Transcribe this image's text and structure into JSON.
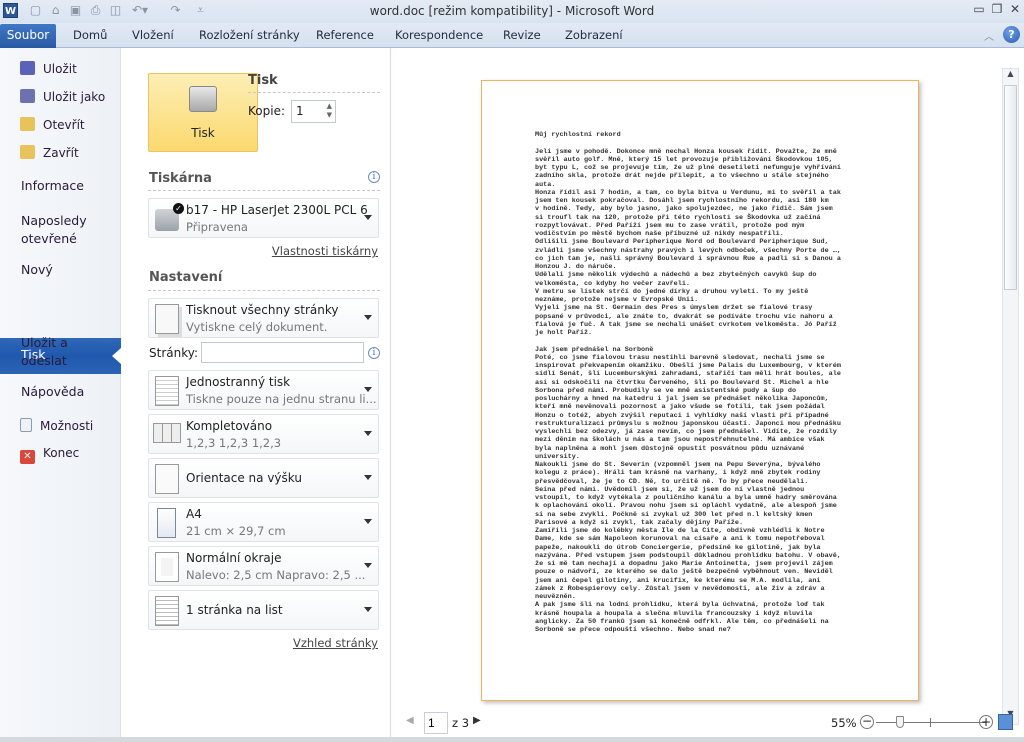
{
  "window": {
    "title": "word.doc [režim kompatibility]  -  Microsoft Word",
    "app_icon": "W"
  },
  "ribbon": {
    "tabs": [
      {
        "label": "Soubor"
      },
      {
        "label": "Domů"
      },
      {
        "label": "Vložení"
      },
      {
        "label": "Rozložení stránky"
      },
      {
        "label": "Reference"
      },
      {
        "label": "Korespondence"
      },
      {
        "label": "Revize"
      },
      {
        "label": "Zobrazení"
      }
    ],
    "help": "?"
  },
  "nav": {
    "items": [
      {
        "label": "Uložit"
      },
      {
        "label": "Uložit jako"
      },
      {
        "label": "Otevřít"
      },
      {
        "label": "Zavřít"
      },
      {
        "label": "Informace"
      },
      {
        "label": "Naposledy otevřené"
      },
      {
        "label": "Nový"
      },
      {
        "label": "Tisk"
      },
      {
        "label": "Uložit a odeslat"
      },
      {
        "label": "Nápověda"
      },
      {
        "label": "Možnosti"
      },
      {
        "label": "Konec"
      }
    ],
    "selected": "Tisk",
    "accent": "#2a5ea8"
  },
  "print": {
    "button_label": "Tisk",
    "heading": "Tisk",
    "copies_label": "Kopie:",
    "copies_value": "1",
    "printer_heading": "Tiskárna",
    "printer_name": "b17 - HP LaserJet 2300L PCL 6",
    "printer_status": "Připravena",
    "printer_props_link": "Vlastnosti tiskárny",
    "settings_heading": "Nastavení",
    "pages_label": "Stránky:",
    "pages_value": "",
    "settings": [
      {
        "title": "Tisknout všechny stránky",
        "subtitle": "Vytiskne celý dokument."
      },
      {
        "title": "Jednostranný tisk",
        "subtitle": "Tiskne pouze na jednu stranu li..."
      },
      {
        "title": "Kompletováno",
        "subtitle": "1,2,3    1,2,3    1,2,3"
      },
      {
        "title": "Orientace na výšku",
        "subtitle": ""
      },
      {
        "title": "A4",
        "subtitle": "21 cm × 29,7 cm"
      },
      {
        "title": "Normální okraje",
        "subtitle": "Nalevo:  2,5 cm   Napravo:  2,5 ..."
      },
      {
        "title": "1 stránka na list",
        "subtitle": ""
      }
    ],
    "page_setup_link": "Vzhled stránky"
  },
  "preview": {
    "current_page": "1",
    "of_pages": "z 3",
    "zoom": "55%",
    "zoom_fraction": 0.22,
    "lines": [
      "Můj rychlostní rekord",
      "",
      "Jeli jsme v pohodě. Dokonce mně nechal Honza kousek řídit. Považte, že mně",
      "svěřil auto golf. Mně, který 15 let provozuje přibližování Škodovkou 105,",
      "byt typu L, což se projevuje tím, že už plné desetiletí nefunguje vyhřívání",
      "zadního skla, protože drát nejde přilepit, a to všechno u stále stejného",
      "auta.",
      "Honza řídil asi 7 hodin, a tam, co byla bitva u Verdunu, mi to svěřil a tak",
      "jsem ten kousek pokračoval. Dosáhl jsem rychlostního rekordu, asi 180 km",
      "v hodině. Tedy, aby bylo jasno, jako spolujezdec, ne jako řidič. Sám jsem",
      "si troufl tak na 120, protože při této rychlosti se Škodovka už začíná",
      "rozpytlovávat. Před Paříží jsem mu to zase vrátil, protože pod mým",
      "vodičstvím po městě bychom naše příbuzné už nikdy nespatřili.",
      "Odlišili jsme Boulevard Peripherique Nord od Boulevard Peripherique Sud,",
      "zvládli jsme všechny nástrahy pravých i levých odboček, všechny Porte de …,",
      "co jich tam je, našli správný Boulevard i správnou Rue a padli si s Danou a",
      "Honzou J. do náruče.",
      "Udělali jsme několik výdechů a nádechů a bez zbytečných cavyků šup do",
      "velkoměsta, co kdyby ho večer zavřeli.",
      "V metru se lístek strčí do jedné dírky a druhou vyletí. To my ještě",
      "neznáme, protože nejsme v Evropské Unii.",
      "Vyjeli jsme na St. Germain des Pres s úmyslem držet se fialové trasy",
      "popsané v průvodci, ale znáte to, dvakrát se podíváte trochu víc nahoru a",
      "fialová je fuč. A tak jsme se nechali unášet cvrkotem velkoměsta. Jó Paříž",
      "je holt Paříž.",
      "",
      "Jak jsem přednášel na Sorboně",
      "Poté, co jsme fialovou trasu nestihli barevně sledovat, nechali jsme se",
      "inspirovat překvapením okamžiku. Obešli jsme Palais du Luxembourg, v kterém",
      "sídlí Senát, šli Lucemburskými zahradami, stařičí tam měli hrát boules, ale",
      "asi si odskočili na čtvrtku Červeného, šli po Boulevard St. Michel a hle",
      "Sorbona před námi. Probudily se ve mně asistentské pudy a šup do",
      "posluchárny a hned na katedru i jal jsem se přednášet několika Japoncům,",
      "kteří mně nevěnovali pozornost a jako všude se fotili, tak jsem požádal",
      "Honzu o totéž, abych zvýšil reputaci i vyhlídky naší vlasti při případné",
      "restrukturalizaci průmyslu s možnou japonskou účastí. Japonci mou přednášku",
      "vyslechli bez odezvy, já zase nevím, co jsem přednášel. Vidíte, že rozdíly",
      "mezi děním na školách u nás a tam jsou nepostřehnutelné. Má ambice však",
      "byla naplněna a mohl jsem důstojně opustit posvátnou půdu uznávané",
      "university.",
      "Nakoukli jsme do St. Severin (vzpomněl jsem na Pepu Severýna, bývalého",
      "kolegu z práce). Hráli tam krásně na varhany, i když mně zbytek rodiny",
      "přesvědčoval, že je to CD. Ně, to určitě ně. To by přece neudělali.",
      "Seina před námi. Uvědomil jsem si, že už jsem do ní vlastně jednou",
      "vstoupil, to když vytékala z pouličního kanálu a byla umně hadry směrována",
      "k oplachování okolí. Pravou nohu jsem si opláchl vydatně, ale alespoň jsme",
      "si na sebe zvykli. Počkně si zvykal už 300 let před n.l keltský kmen",
      "Parisové a když si zvykl, tak začaly dějiny Paříže.",
      "Zamířili jsme do kolébky města Ile de la Cite, obdivně vzhlédli k Notre",
      "Dame, kde se sám Napoleon korunoval na císaře a ani k tomu nepotřeboval",
      "papeže, nakoukli do útrob Conciergerie, předsíně ke gilotině, jak byla",
      "nazývána. Před vstupem jsem podstoupil důkladnou prohlídku batohu. V obavě,",
      "že si mě tam nechají a dopadnu jako Marie Antoinetta, jsem projevil zájem",
      "pouze o nádvoří, ze kterého se dalo ještě bezpečně vyběhnout ven. Neviděl",
      "jsem ani čepel gilotiny, ani krucifix, ke kterému se M.A. modlila, ani",
      "zámek z Robespierovy cely. Zůstal jsem v nevědomosti, ale živ a zdráv a",
      "neuvězněn.",
      "A pak jsme šli na lodní prohlídku, která byla úchvatná, protože loď tak",
      "krásně houpala a houpala a slečna mluvila francouzsky i když mluvila",
      "anglicky. Za 50 franků jsem si konečně odfrkl. Ale těm, co přednášeli na",
      "Sorboně se přece odpouští všechno. Nebo snad ne?"
    ]
  }
}
